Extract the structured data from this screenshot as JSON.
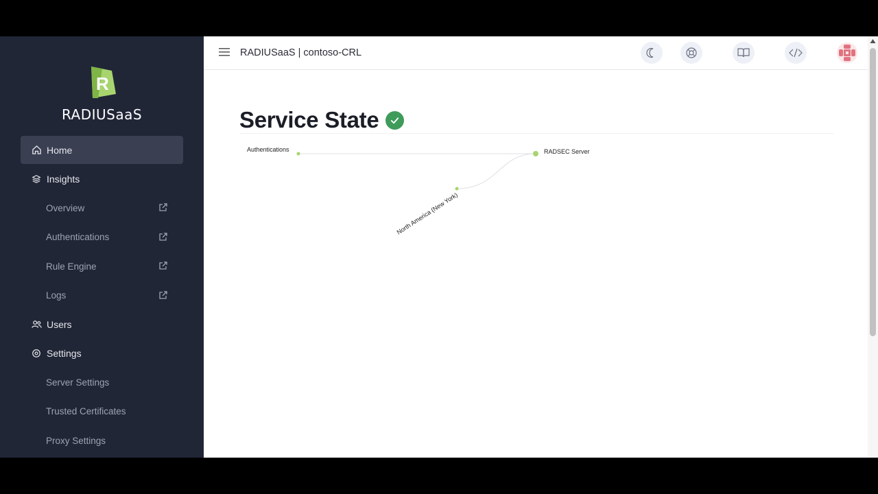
{
  "brand": {
    "name": "RADIUSaaS",
    "logo_letter": "R",
    "accent": "#a8d46f"
  },
  "sidebar": {
    "items": [
      {
        "label": "Home",
        "icon": "home-icon",
        "active": true
      },
      {
        "label": "Insights",
        "icon": "layers-icon"
      },
      {
        "label": "Overview",
        "sub": true,
        "external": true
      },
      {
        "label": "Authentications",
        "sub": true,
        "external": true
      },
      {
        "label": "Rule Engine",
        "sub": true,
        "external": true
      },
      {
        "label": "Logs",
        "sub": true,
        "external": true
      },
      {
        "label": "Users",
        "icon": "users-icon"
      },
      {
        "label": "Settings",
        "icon": "settings-icon"
      },
      {
        "label": "Server Settings",
        "sub": true
      },
      {
        "label": "Trusted Certificates",
        "sub": true
      },
      {
        "label": "Proxy Settings",
        "sub": true
      }
    ]
  },
  "header": {
    "title": "RADIUSaaS | contoso-CRL"
  },
  "toolbar": {
    "buttons": [
      "moon-icon",
      "lifebuoy-icon",
      "book-icon",
      "code-icon"
    ],
    "avatar": "avatar-icon"
  },
  "main": {
    "title": "Service State",
    "status": "ok",
    "status_color": "#3f9b5a"
  },
  "graph": {
    "nodes": {
      "authentications": "Authentications",
      "radsec": "RADSEC Server",
      "region": "North America (New York)"
    },
    "node_color": "#a8d46f"
  }
}
